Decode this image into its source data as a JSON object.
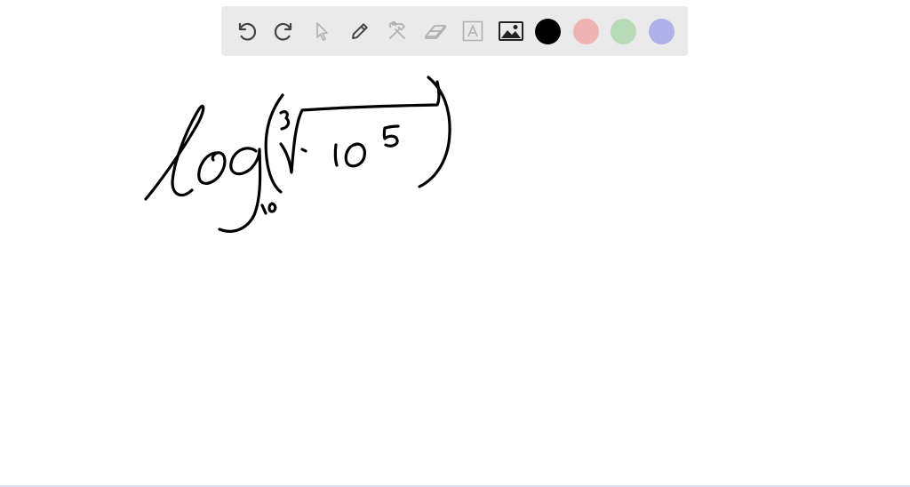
{
  "toolbar": {
    "tools": [
      {
        "name": "undo-icon",
        "icon": "undo"
      },
      {
        "name": "redo-icon",
        "icon": "redo"
      },
      {
        "name": "select-pointer-icon",
        "icon": "pointer"
      },
      {
        "name": "pen-icon",
        "icon": "pen"
      },
      {
        "name": "tools-icon",
        "icon": "hammer-wrench"
      },
      {
        "name": "eraser-icon",
        "icon": "eraser"
      },
      {
        "name": "text-icon",
        "icon": "text-A"
      },
      {
        "name": "image-icon",
        "icon": "image"
      }
    ],
    "colors": {
      "black": "#000000",
      "red": "#efb3b3",
      "green": "#b7dbb7",
      "blue": "#b0b0ea"
    },
    "active_color": "black",
    "background": "#eaeaea"
  },
  "canvas": {
    "background": "#ffffff",
    "ink_color": "#000000"
  }
}
